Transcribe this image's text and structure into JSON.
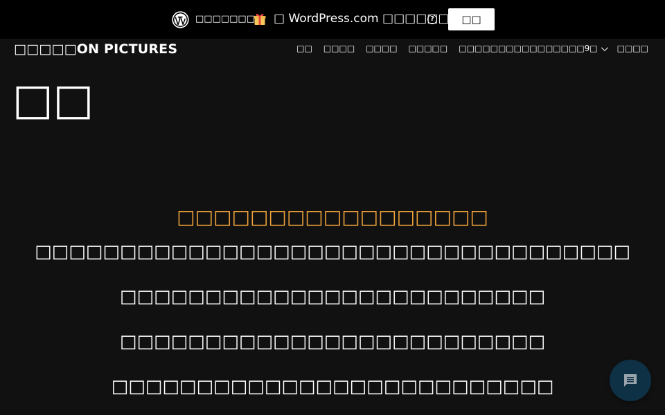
{
  "promo_bar": {
    "text_left": "□□□□□□□□",
    "text_right": "□ WordPress.com □□□□□□□□",
    "button_label": "□□",
    "help_glyph": "?",
    "icons": [
      "wordpress-logo-icon",
      "gift-icon",
      "help-icon"
    ]
  },
  "header": {
    "site_title": "□□□□□ON PICTURES",
    "nav": [
      {
        "label": "□□"
      },
      {
        "label": "□□□□"
      },
      {
        "label": "□□□□"
      },
      {
        "label": "□□□□□"
      },
      {
        "label": "□□□□□□□□□□□□□□□□9□",
        "has_dropdown": true
      },
      {
        "label": "□□□□"
      }
    ]
  },
  "page": {
    "title": "□□"
  },
  "content": {
    "heading": "□□□□□□□□□□□□□□□□□",
    "lines": [
      "□□□□□□□□□□□□□□□□□□□□□□□□□□□□□□□□□□□",
      "□□□□□□□□□□□□□□□□□□□□□□□□□",
      "□□□□□□□□□□□□□□□□□□□□□□□□□",
      "□□□□□□□□□□□□□□□□□□□□□□□□□□"
    ]
  },
  "colors": {
    "background": "#111111",
    "promo_bar": "#000000",
    "heading_accent": "#f0a33c",
    "chat_button": "#0f3145"
  },
  "chat": {
    "icon": "chat-icon"
  }
}
